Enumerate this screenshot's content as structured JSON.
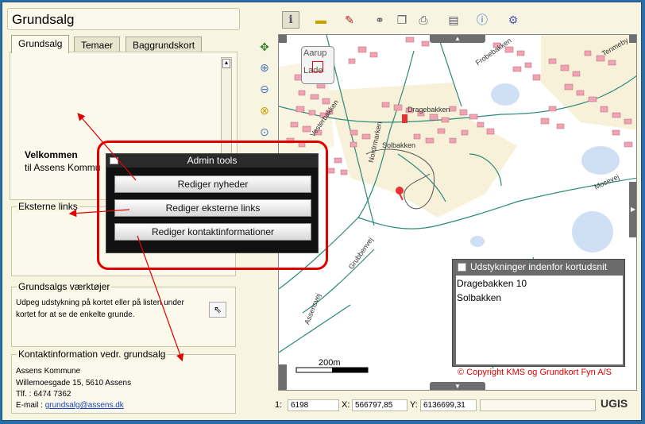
{
  "app": {
    "title": "Grundsalg"
  },
  "tabs": [
    {
      "label": "Grundsalg"
    },
    {
      "label": "Temaer"
    },
    {
      "label": "Baggrundskort"
    }
  ],
  "welcome": {
    "heading": "Velkommen",
    "text": "til Assens Kommu"
  },
  "external_links": {
    "title": "Eksterne links"
  },
  "tools_box": {
    "title": "Grundsalgs værktøjer",
    "text": "Udpeg udstykning på kortet eller på listen under kortet for at se de enkelte grunde."
  },
  "contact": {
    "title": "Kontaktinformation vedr. grundsalg",
    "line1": "Assens Kommune",
    "line2": "Willemoesgade 15, 5610 Assens",
    "line3": "Tlf. : 6474 7362",
    "email_label": "E-mail :",
    "email": "grundsalg@assens.dk"
  },
  "admin_dialog": {
    "title": "Admin tools",
    "buttons": [
      {
        "label": "Rediger nyheder"
      },
      {
        "label": "Rediger eksterne links"
      },
      {
        "label": "Rediger kontaktinformationer"
      }
    ]
  },
  "results_panel": {
    "title": "Udstykninger indenfor kortudsnit",
    "items": [
      "Dragebakken 10",
      "Solbakken"
    ]
  },
  "map": {
    "overview_labels": [
      "Aarup",
      "Lade"
    ],
    "street_labels": [
      "Dragebakken",
      "Solbakken",
      "Nordrmarken",
      "Vesterbakken",
      "Assensvej",
      "Mosevej",
      "Grubbenvej",
      "Frobebakken",
      "Tenmeby"
    ],
    "scale_label": "200m",
    "copyright": "© Copyright KMS og Grundkort Fyn A/S"
  },
  "status_bar": {
    "scale_label": "1:",
    "scale_value": "6198",
    "x_label": "X:",
    "x_value": "566797,85",
    "y_label": "Y:",
    "y_value": "6136699,31",
    "logo": "UGIS"
  },
  "colors": {
    "accent": "#e10000",
    "map_building": "#f2a3b2",
    "map_water": "#cfe0f5",
    "map_road": "#2b8a7a"
  }
}
